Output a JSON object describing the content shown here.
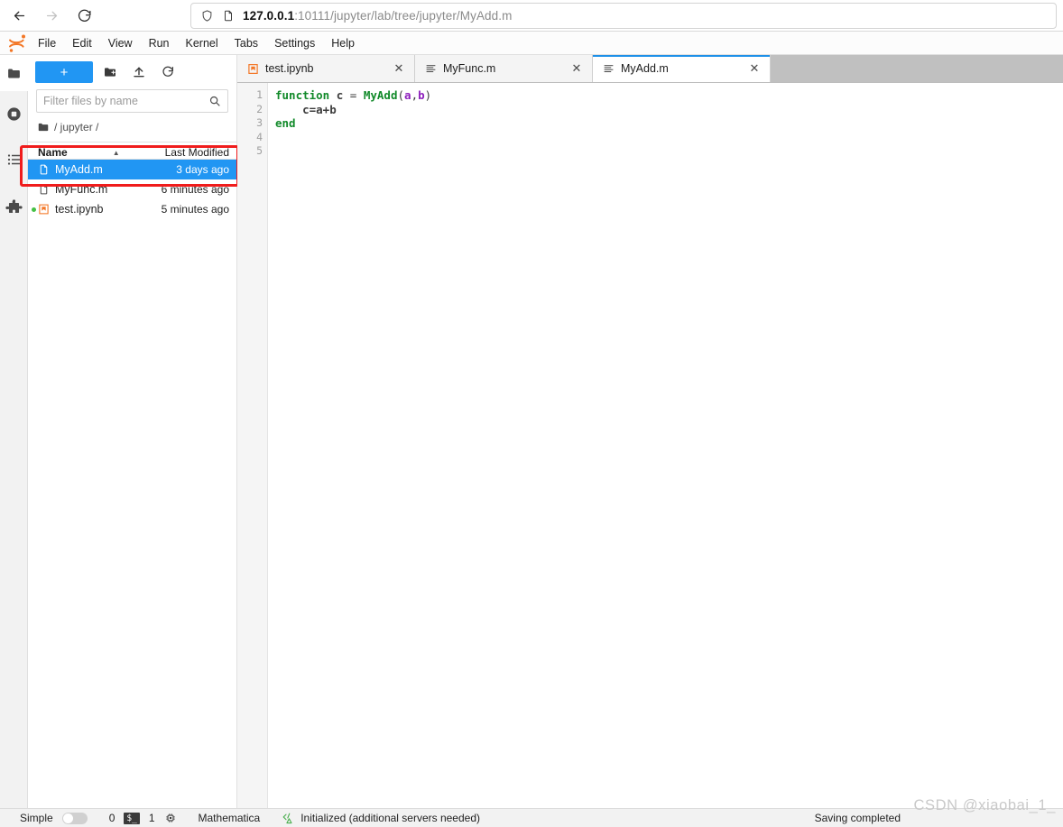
{
  "browser": {
    "back_icon": "arrow-left-icon",
    "forward_icon": "arrow-right-icon",
    "reload_icon": "reload-icon",
    "shield_icon": "shield-icon",
    "page_icon": "page-icon",
    "url_host": "127.0.0.1",
    "url_path": ":10111/jupyter/lab/tree/jupyter/MyAdd.m"
  },
  "menubar": {
    "logo": "jupyter-logo",
    "items": [
      "File",
      "Edit",
      "View",
      "Run",
      "Kernel",
      "Tabs",
      "Settings",
      "Help"
    ]
  },
  "activity_bar": {
    "items": [
      {
        "name": "file-browser-icon",
        "glyph": "folder"
      },
      {
        "name": "running-terminals-icon",
        "glyph": "stop"
      },
      {
        "name": "commands-icon",
        "glyph": "list"
      },
      {
        "name": "extension-manager-icon",
        "glyph": "puzzle"
      }
    ]
  },
  "file_browser": {
    "new_launcher_label": "+",
    "new_folder_icon": "new-folder-icon",
    "upload_icon": "upload-icon",
    "refresh_icon": "refresh-icon",
    "filter_placeholder": "Filter files by name",
    "filter_value": "",
    "search_icon": "search-icon",
    "breadcrumb_icon": "folder-icon",
    "breadcrumb": "/ jupyter /",
    "columns": [
      "Name",
      "Last Modified"
    ],
    "sort_caret": "▲",
    "rows": [
      {
        "name": "MyAdd.m",
        "modified": "3 days ago",
        "icon": "file-icon",
        "selected": true,
        "running": false
      },
      {
        "name": "MyFunc.m",
        "modified": "6 minutes ago",
        "icon": "file-icon",
        "selected": false,
        "running": false
      },
      {
        "name": "test.ipynb",
        "modified": "5 minutes ago",
        "icon": "notebook-icon",
        "selected": false,
        "running": true
      }
    ]
  },
  "annotation": {
    "highlight_color": "#f01c1c",
    "target": "MyAdd.m row"
  },
  "tabs": [
    {
      "label": "test.ipynb",
      "icon": "notebook-icon",
      "active": false,
      "close_icon": "close-icon"
    },
    {
      "label": "MyFunc.m",
      "icon": "text-file-icon",
      "active": false,
      "close_icon": "close-icon"
    },
    {
      "label": "MyAdd.m",
      "icon": "text-file-icon",
      "active": true,
      "close_icon": "close-icon"
    }
  ],
  "editor": {
    "line_numbers": [
      "1",
      "2",
      "3",
      "4",
      "5"
    ],
    "lines": [
      [
        {
          "t": "function",
          "c": "k"
        },
        {
          "t": " ",
          "c": "op"
        },
        {
          "t": "c",
          "c": "var"
        },
        {
          "t": " = ",
          "c": "op"
        },
        {
          "t": "MyAdd",
          "c": "fn"
        },
        {
          "t": "(",
          "c": "op"
        },
        {
          "t": "a",
          "c": "pur"
        },
        {
          "t": ",",
          "c": "op"
        },
        {
          "t": "b",
          "c": "pur"
        },
        {
          "t": ")",
          "c": "op"
        }
      ],
      [
        {
          "t": "    ",
          "c": "op"
        },
        {
          "t": "c=a+b",
          "c": "var"
        }
      ],
      [
        {
          "t": "end",
          "c": "k"
        }
      ],
      [],
      []
    ]
  },
  "statusbar": {
    "mode_label": "Simple",
    "toggle_state": "off",
    "kernel_count": "0",
    "terminal_icon": "terminal-icon",
    "terminal_count": "1",
    "cpu_icon": "cpu-icon",
    "kernel_name": "Mathematica",
    "server_icon": "code-server-icon",
    "server_status": "Initialized (additional servers needed)",
    "save_status": "Saving completed"
  },
  "watermark": "CSDN @xiaobai_1_"
}
